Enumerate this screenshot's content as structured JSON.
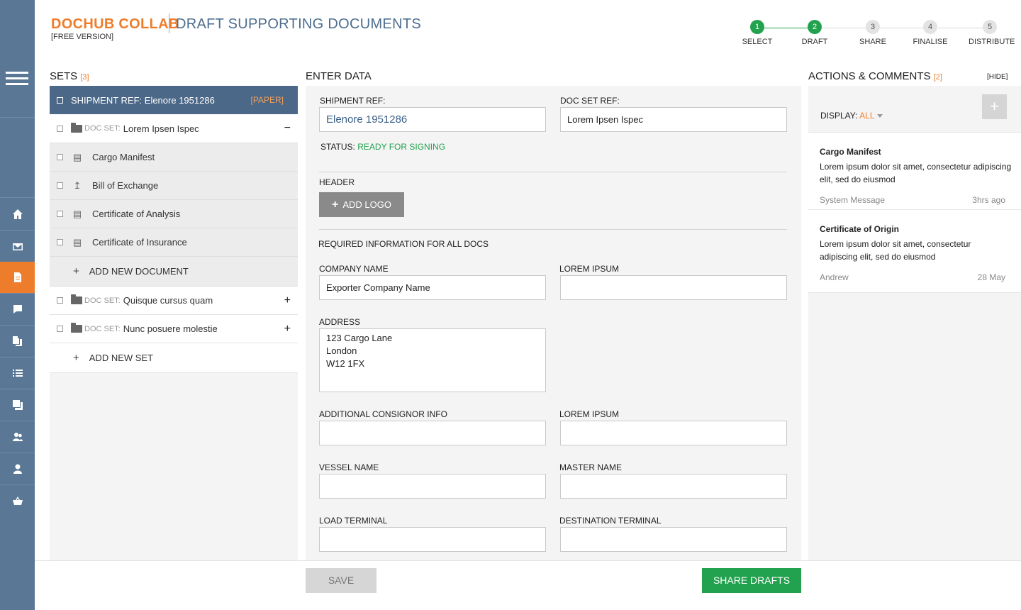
{
  "app": {
    "brand": "DOCHUB COLLAB",
    "version": "[FREE VERSION]",
    "page_title": "DRAFT SUPPORTING DOCUMENTS"
  },
  "steps": [
    {
      "num": "1",
      "label": "SELECT"
    },
    {
      "num": "2",
      "label": "DRAFT"
    },
    {
      "num": "3",
      "label": "SHARE"
    },
    {
      "num": "4",
      "label": "FINALISE"
    },
    {
      "num": "5",
      "label": "DISTRIBUTE"
    }
  ],
  "sets": {
    "title": "SETS",
    "count": "[3]",
    "shipment": {
      "label": "SHIPMENT REF: Elenore 1951286",
      "tag": "[PAPER]"
    },
    "doc_set_label": "DOC SET:",
    "doc_sets": [
      {
        "name": "Lorem Ipsen Ispec",
        "action": "−"
      },
      {
        "name": "Quisque cursus quam",
        "action": "+"
      },
      {
        "name": "Nunc posuere molestie",
        "action": "+"
      }
    ],
    "documents": [
      {
        "name": "Cargo Manifest",
        "icon": "document-icon"
      },
      {
        "name": "Bill of Exchange",
        "icon": "upload-icon"
      },
      {
        "name": "Certificate of Analysis",
        "icon": "document-icon"
      },
      {
        "name": "Certificate of Insurance",
        "icon": "document-icon"
      }
    ],
    "add_document": "ADD NEW DOCUMENT",
    "add_set": "ADD NEW SET"
  },
  "form": {
    "title": "ENTER DATA",
    "shipment_ref_label": "SHIPMENT REF:",
    "shipment_ref_value": "Elenore 1951286",
    "doc_set_ref_label": "DOC SET REF:",
    "doc_set_ref_value": "Lorem Ipsen Ispec",
    "status_label": "STATUS:",
    "status_value": "READY FOR SIGNING",
    "header_label": "HEADER",
    "add_logo": "ADD LOGO",
    "required_label": "REQUIRED INFORMATION FOR ALL DOCS",
    "company_name_label": "COMPANY NAME",
    "company_name_value": "Exporter Company Name",
    "lorem_ipsum_label": "LOREM IPSUM",
    "address_label": "ADDRESS",
    "address_value": "123 Cargo Lane\nLondon\nW12 1FX",
    "additional_consignor_label": "ADDITIONAL CONSIGNOR INFO",
    "lorem_ipsum_label_2": "LOREM IPSUM",
    "vessel_name_label": "VESSEL NAME",
    "master_name_label": "MASTER NAME",
    "load_terminal_label": "LOAD TERMINAL",
    "destination_terminal_label": "DESTINATION TERMINAL"
  },
  "actions": {
    "title": "ACTIONS & COMMENTS",
    "count": "[2]",
    "hide": "[HIDE]",
    "display_label": "DISPLAY:",
    "display_value": "ALL",
    "add_icon": "plus-icon",
    "comments": [
      {
        "title": "Cargo Manifest",
        "body": "Lorem ipsum dolor sit amet, consectetur adipiscing elit, sed do eiusmod",
        "author": "System Message",
        "when": "3hrs ago"
      },
      {
        "title": "Certificate of Origin",
        "body": "Lorem ipsum dolor sit amet, consectetur adipiscing elit, sed do eiusmod",
        "author": "Andrew",
        "when": "28 May"
      }
    ]
  },
  "footer": {
    "save": "SAVE",
    "share": "SHARE DRAFTS"
  },
  "colors": {
    "accent": "#ee7d2b",
    "rail": "#5a7896",
    "primary": "#4c6888",
    "success": "#22a24e"
  },
  "rail_icons": [
    "menu-icon",
    "home-icon",
    "mail-icon",
    "document-icon",
    "chat-icon",
    "files-icon",
    "list-icon",
    "copy-icon",
    "users-icon",
    "user-icon",
    "basket-icon"
  ]
}
